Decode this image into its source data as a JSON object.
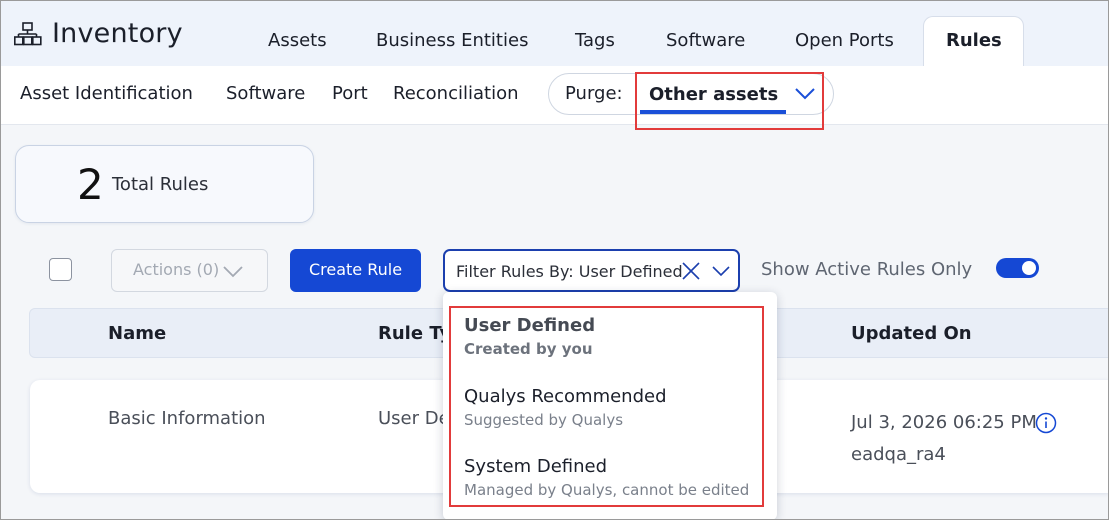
{
  "app": {
    "title": "Inventory",
    "logo_icon": "hierarchy-icon"
  },
  "main_tabs": [
    {
      "label": "Assets",
      "active": false
    },
    {
      "label": "Business Entities",
      "active": false
    },
    {
      "label": "Tags",
      "active": false
    },
    {
      "label": "Software",
      "active": false
    },
    {
      "label": "Open Ports",
      "active": false
    },
    {
      "label": "Rules",
      "active": true
    }
  ],
  "sub_nav": {
    "items": [
      "Asset Identification",
      "Software",
      "Port",
      "Reconciliation"
    ],
    "purge": {
      "label": "Purge:",
      "selected": "Other assets"
    }
  },
  "stats": {
    "total_count": "2",
    "total_label": "Total Rules"
  },
  "toolbar": {
    "actions_label": "Actions (0)",
    "create_label": "Create Rule",
    "filter_prefix": "Filter Rules By:",
    "filter_value": "User Defined",
    "active_only_label": "Show Active Rules Only",
    "active_only_enabled": true
  },
  "table": {
    "columns": [
      "Name",
      "Rule Ty",
      "Updated On"
    ],
    "rows": [
      {
        "name": "Basic Information",
        "rule_type": "User De",
        "updated_on": "Jul 3, 2026 06:25 PM",
        "updated_by": "eadqa_ra4"
      }
    ]
  },
  "filter_dropdown": {
    "options": [
      {
        "title": "User Defined",
        "subtitle": "Created by you",
        "selected": true
      },
      {
        "title": "Qualys Recommended",
        "subtitle": "Suggested by Qualys",
        "selected": false
      },
      {
        "title": "System Defined",
        "subtitle": "Managed by Qualys, cannot be edited",
        "selected": false
      }
    ]
  },
  "colors": {
    "primary": "#1548d4",
    "highlight": "#e23b3b",
    "header_bg": "#eef3fb"
  }
}
